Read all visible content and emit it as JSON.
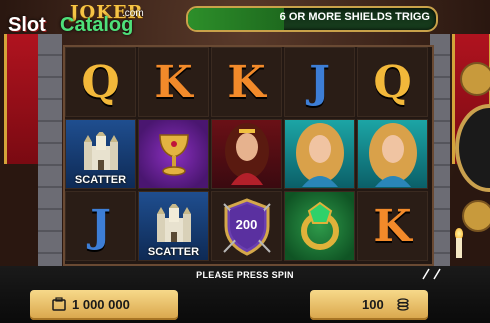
{
  "logo": {
    "joker": "JOKER",
    "slot": "Slot",
    "catalog": "Catalog",
    "com": ".com"
  },
  "ticker": {
    "text": "6 OR MORE SHIELDS TRIGG"
  },
  "reels": {
    "row1": [
      "Q",
      "K",
      "K",
      "J",
      "Q"
    ],
    "scatter_label": "SCATTER",
    "shield_value": "200",
    "row3": [
      "J",
      "K"
    ]
  },
  "status": {
    "message": "PLEASE PRESS SPIN"
  },
  "balance": {
    "value": "1 000 000"
  },
  "bet": {
    "value": "100"
  },
  "colors": {
    "gold": "#f2b83a",
    "orange": "#f28a2a",
    "blue": "#3d7ed6",
    "panel": "#f7d98a"
  }
}
